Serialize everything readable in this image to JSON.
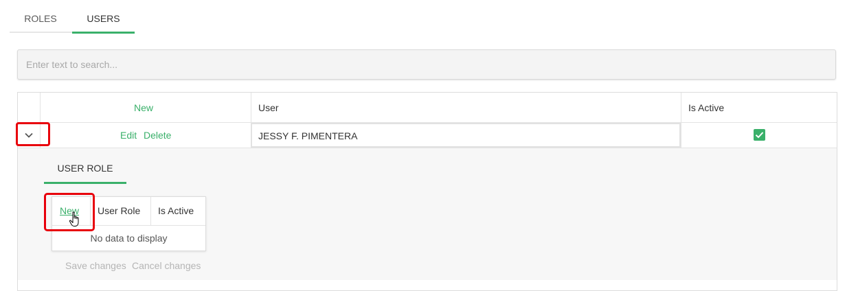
{
  "tabs": [
    {
      "label": "ROLES",
      "active": false
    },
    {
      "label": "USERS",
      "active": true
    }
  ],
  "search": {
    "placeholder": "Enter text to search..."
  },
  "grid": {
    "columns": {
      "new": "New",
      "user": "User",
      "is_active": "Is Active"
    },
    "rows": [
      {
        "edit": "Edit",
        "delete": "Delete",
        "user": "JESSY F. PIMENTERA",
        "is_active": true
      }
    ]
  },
  "detail": {
    "tab": "USER ROLE",
    "columns": {
      "new": "New",
      "user_role": "User Role",
      "is_active": "Is Active"
    },
    "empty_text": "No data to display",
    "save_changes": "Save changes",
    "cancel_changes": "Cancel changes"
  },
  "colors": {
    "accent": "#3ab06a",
    "highlight": "#e8000b"
  }
}
